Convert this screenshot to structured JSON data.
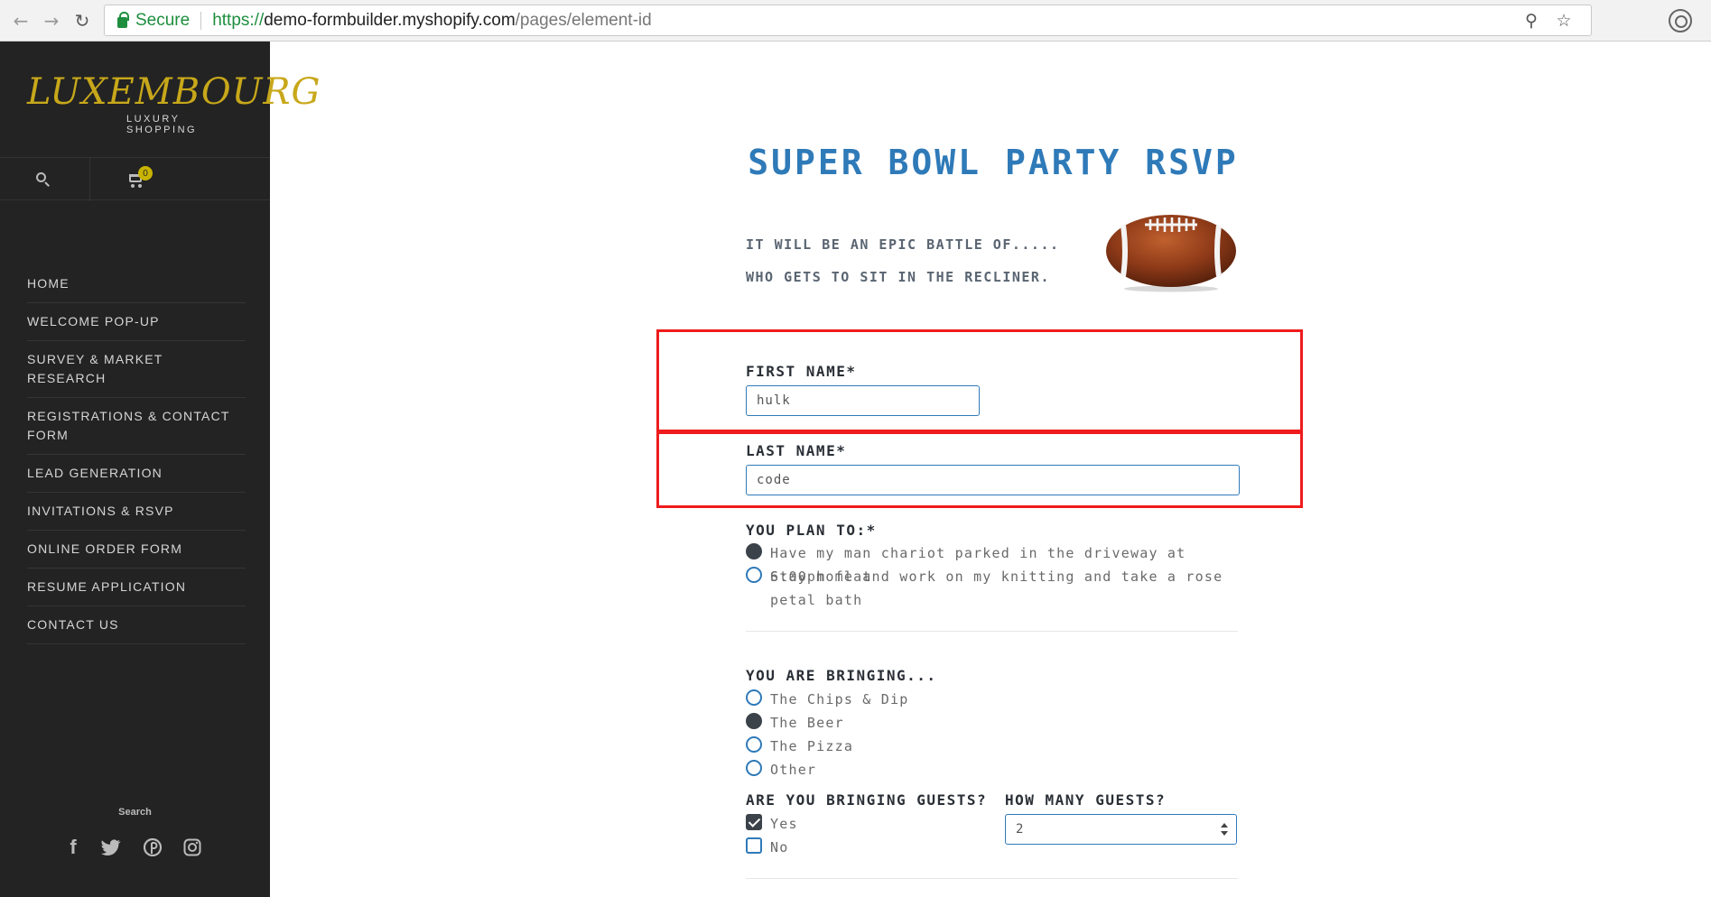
{
  "browser": {
    "secure_label": "Secure",
    "url_scheme": "https://",
    "url_host": "demo-formbuilder.myshopify.com",
    "url_path": "/pages/element-id",
    "icons": [
      "back-icon",
      "forward-icon",
      "reload-icon",
      "lock-icon",
      "zoom-icon",
      "star-icon",
      "extension-icon"
    ]
  },
  "sidebar": {
    "logo_main": "LUXEMBOURG",
    "logo_sub": "LUXURY SHOPPING",
    "cart_count": "0",
    "menu": [
      "HOME",
      "WELCOME POP-UP",
      "SURVEY & MARKET RESEARCH",
      "REGISTRATIONS & CONTACT FORM",
      "LEAD GENERATION",
      "INVITATIONS & RSVP",
      "ONLINE ORDER FORM",
      "RESUME APPLICATION",
      "CONTACT US"
    ],
    "search_label": "Search",
    "social_icons": [
      "facebook-icon",
      "twitter-icon",
      "pinterest-icon",
      "instagram-icon"
    ]
  },
  "form": {
    "title": "SUPER BOWL PARTY RSVP",
    "tagline_1": "IT WILL BE AN EPIC BATTLE OF.....",
    "tagline_2": "WHO GETS TO SIT IN THE RECLINER.",
    "first_name_label": "FIRST NAME*",
    "first_name_value": "hulk",
    "last_name_label": "LAST NAME*",
    "last_name_value": "code",
    "plan_label": "YOU PLAN TO:*",
    "plan_options": [
      "Have my man chariot parked in the driveway at 6:00pm flat",
      "Stay home and work on my knitting and take a rose petal bath"
    ],
    "plan_selected": 0,
    "bringing_label": "YOU ARE BRINGING...",
    "bringing_options": [
      "The Chips & Dip",
      "The Beer",
      "The Pizza",
      "Other"
    ],
    "bringing_selected": 1,
    "guests_label": "ARE YOU BRINGING GUESTS?",
    "guests_options": [
      "Yes",
      "No"
    ],
    "guests_checked": [
      true,
      false
    ],
    "how_many_label": "HOW MANY GUESTS?",
    "how_many_value": "2"
  },
  "colors": {
    "sidebar_bg": "#232323",
    "logo_gold": "#c8a81a",
    "title_blue": "#2f7ab8",
    "highlight_red": "#ee1c1c",
    "secure_green": "#1e8e3e"
  }
}
